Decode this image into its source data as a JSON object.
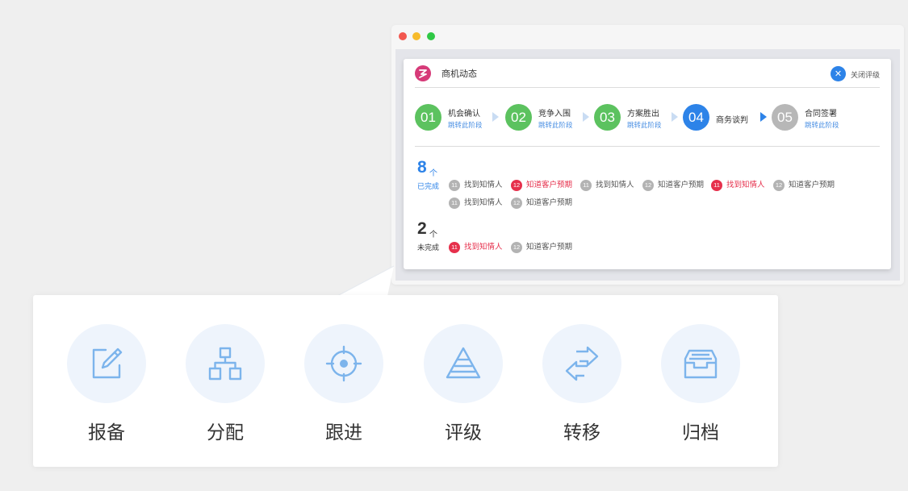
{
  "window": {
    "title": "商机动态",
    "close_label": "关闭评级",
    "close_icon": "close-icon"
  },
  "stages": [
    {
      "num": "01",
      "name": "机会确认",
      "link": "跳转此阶段",
      "color": "#5cc25f"
    },
    {
      "num": "02",
      "name": "竞争入围",
      "link": "跳转此阶段",
      "color": "#5cc25f"
    },
    {
      "num": "03",
      "name": "方案胜出",
      "link": "跳转此阶段",
      "color": "#5cc25f"
    },
    {
      "num": "04",
      "name": "商务谈判",
      "link": "",
      "color": "#2d83e8"
    },
    {
      "num": "05",
      "name": "合同签署",
      "link": "跳转此阶段",
      "color": "#b7b7b7"
    }
  ],
  "completed": {
    "count": "8",
    "unit": "个",
    "label": "已完成",
    "color": "#2d83e8",
    "tasks": [
      {
        "badge": "11",
        "name": "找到知情人",
        "status": "gray"
      },
      {
        "badge": "12",
        "name": "知道客户预期",
        "status": "red"
      },
      {
        "badge": "11",
        "name": "找到知情人",
        "status": "gray"
      },
      {
        "badge": "12",
        "name": "知道客户预期",
        "status": "gray"
      },
      {
        "badge": "11",
        "name": "找到知情人",
        "status": "red"
      },
      {
        "badge": "12",
        "name": "知道客户预期",
        "status": "gray"
      },
      {
        "badge": "11",
        "name": "找到知情人",
        "status": "gray"
      },
      {
        "badge": "12",
        "name": "知道客户预期",
        "status": "gray"
      }
    ]
  },
  "incomplete": {
    "count": "2",
    "unit": "个",
    "label": "未完成",
    "color": "#333333",
    "tasks": [
      {
        "badge": "11",
        "name": "找到知情人",
        "status": "red"
      },
      {
        "badge": "12",
        "name": "知道客户预期",
        "status": "gray"
      }
    ]
  },
  "features": [
    {
      "label": "报备",
      "icon": "edit-icon"
    },
    {
      "label": "分配",
      "icon": "org-chart-icon"
    },
    {
      "label": "跟进",
      "icon": "target-icon"
    },
    {
      "label": "评级",
      "icon": "pyramid-icon"
    },
    {
      "label": "转移",
      "icon": "transfer-arrows-icon"
    },
    {
      "label": "归档",
      "icon": "archive-tray-icon"
    }
  ],
  "colors": {
    "accent_blue": "#2d83e8",
    "success_green": "#5cc25f",
    "alert_red": "#e6304c",
    "icon_blue": "#7cb4ec",
    "icon_bg": "#eef4fc"
  }
}
